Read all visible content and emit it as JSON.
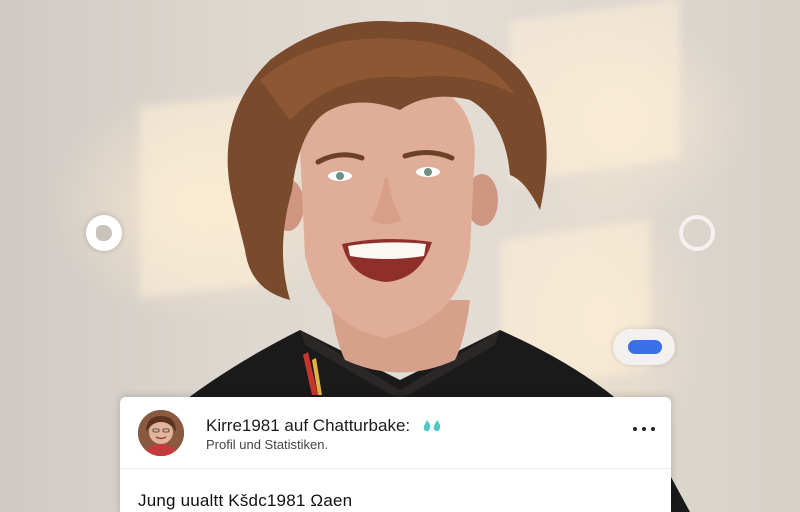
{
  "card": {
    "title": "Kirre1981 auf Chatturbake:",
    "subtitle": "Profil und Statistiken.",
    "body_text": "Jung uualtt Kšdc1981 Ωaen"
  },
  "icons": {
    "title_emoji": "teal-drops-icon",
    "more": "more-options-icon",
    "left_control": "blob-icon",
    "right_control": "ring-icon",
    "toggle": "toggle-switch"
  },
  "colors": {
    "toggle_accent": "#3b6fe6",
    "drop_icon": "#4fc7c3"
  }
}
